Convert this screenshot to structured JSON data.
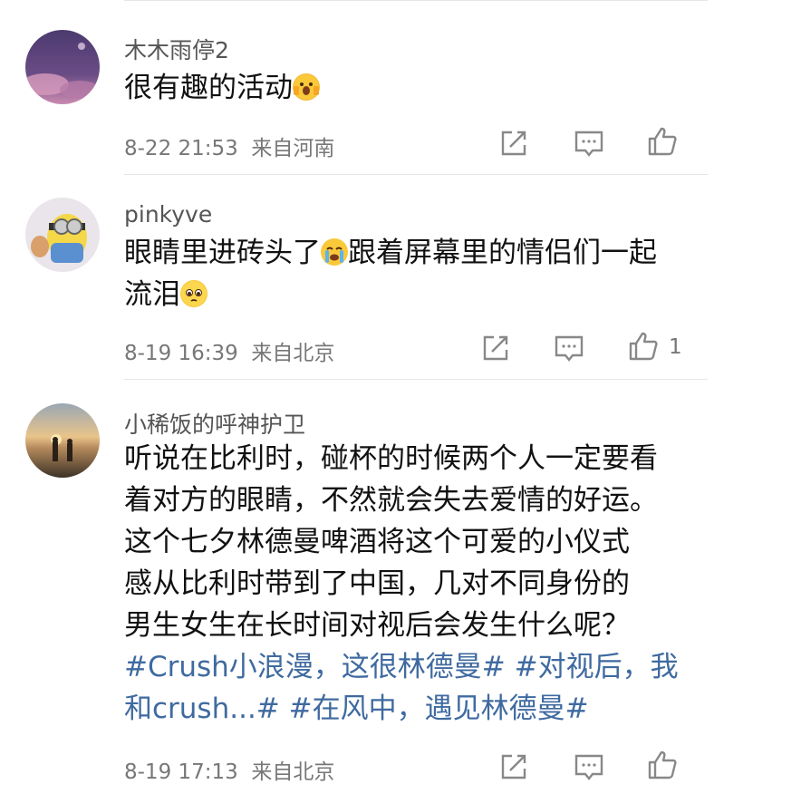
{
  "comments": [
    {
      "username": "木木雨停2",
      "text": "很有趣的活动",
      "emoji": "scream-emoji",
      "date": "8-22 21:53",
      "location": "来自河南"
    },
    {
      "username": "pinkyve",
      "line1a": "眼睛里进砖头了",
      "line1b": "跟着屏幕里的情侣们一起",
      "line2": "流泪",
      "emoji1": "crying-emoji",
      "emoji2": "pleading-emoji",
      "date": "8-19 16:39",
      "location": "来自北京",
      "likes": "1"
    },
    {
      "username": "小稀饭的呼神护卫",
      "lines": [
        "听说在比利时，碰杯的时候两个人一定要看",
        "着对方的眼睛，不然就会失去爱情的好运。",
        "这个七夕林德曼啤酒将这个可爱的小仪式",
        "感从比利时带到了中国，几对不同身份的",
        "男生女生在长时间对视后会发生什么呢？"
      ],
      "tag1": "#Crush小浪漫，这很林德曼#",
      "tag2": "#对视后，我",
      "tag2b": "和crush...#",
      "tag3": "#在风中，遇见林德曼#",
      "date": "8-19 17:13",
      "location": "来自北京"
    }
  ],
  "colors": {
    "tag": "#3f6aa0",
    "meta": "#777777",
    "icon": "#888888"
  }
}
